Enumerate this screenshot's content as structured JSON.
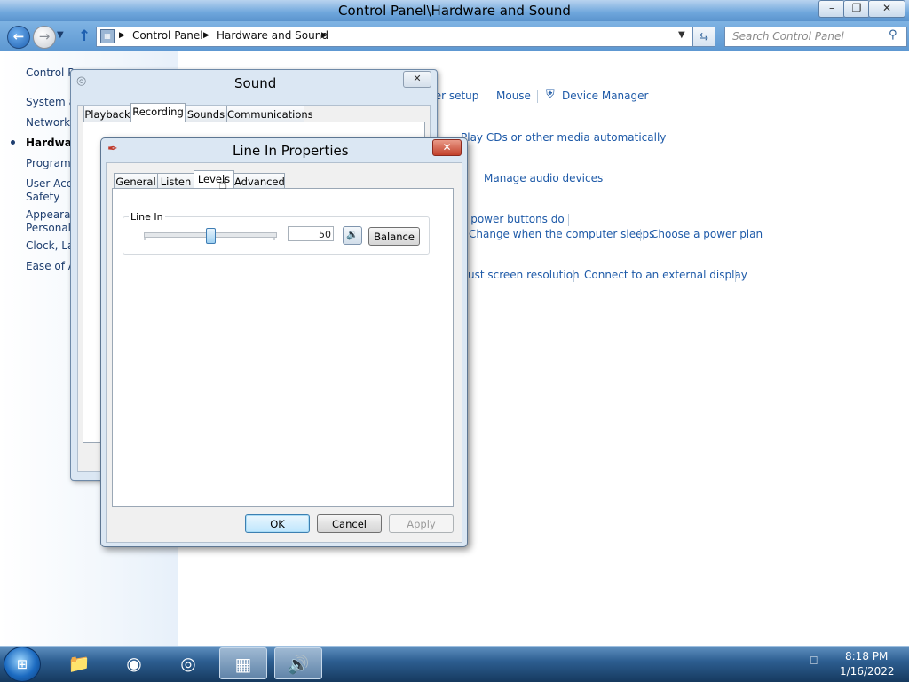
{
  "window": {
    "title": "Control Panel\\Hardware and Sound"
  },
  "address_bar": {
    "crumbs": [
      "Control Panel",
      "Hardware and Sound"
    ],
    "search_placeholder": "Search Control Panel"
  },
  "sidebar": {
    "items": [
      {
        "label": "Control Panel Home"
      },
      {
        "label": "System and Security"
      },
      {
        "label": "Network and Internet"
      },
      {
        "label": "Hardware and Sound"
      },
      {
        "label": "Programs"
      },
      {
        "label": "User Accounts and Family Safety"
      },
      {
        "label": "Appearance and Personalization"
      },
      {
        "label": "Clock, Language, and Region"
      },
      {
        "label": "Ease of Access"
      }
    ],
    "labels_visible": [
      "Control Pa",
      "System a",
      "Network",
      "Hardwar",
      "Programs",
      "User Acco",
      "Safety",
      "Appearan",
      "Personali",
      "Clock, La",
      "Ease of A"
    ]
  },
  "main": {
    "links": [
      "ter setup",
      "Mouse",
      "Device Manager",
      "Play CDs or other media automatically",
      "Manage audio devices",
      "e power buttons do",
      "Change when the computer sleeps",
      "Choose a power plan",
      "ust screen resolution",
      "Connect to an external display"
    ]
  },
  "sound_dialog": {
    "title": "Sound",
    "tabs": [
      "Playback",
      "Recording",
      "Sounds",
      "Communications"
    ],
    "active_tab": "Recording"
  },
  "properties_dialog": {
    "title": "Line In Properties",
    "tabs": [
      "General",
      "Listen",
      "Levels",
      "Advanced"
    ],
    "active_tab": "Levels",
    "group_label": "Line In",
    "level_value": "50",
    "level_fraction": 0.5,
    "balance_label": "Balance",
    "ok_label": "OK",
    "cancel_label": "Cancel",
    "apply_label": "Apply"
  },
  "taskbar": {
    "time": "8:18 PM",
    "date": "1/16/2022",
    "apps": [
      "windows-explorer",
      "firefox",
      "chrome",
      "control-panel",
      "sound"
    ]
  },
  "colors": {
    "accent": "#1e5aa8",
    "title_gradient_top": "#b9d3ef",
    "close_red": "#c2412b"
  }
}
